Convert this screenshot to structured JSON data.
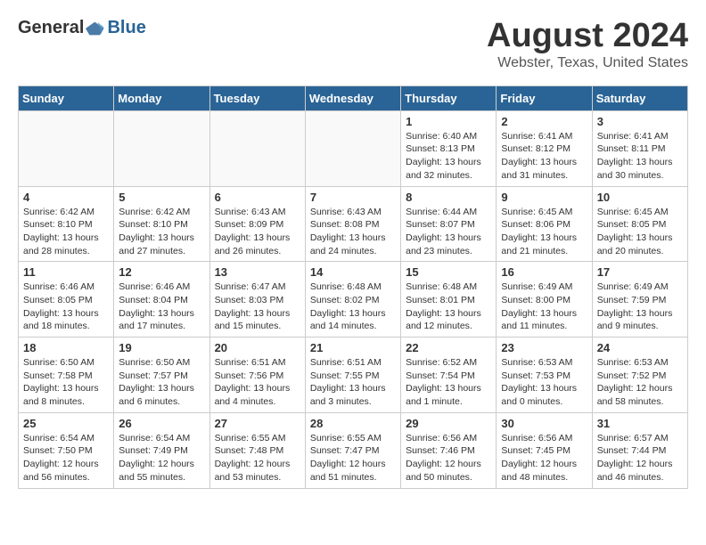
{
  "logo": {
    "general": "General",
    "blue": "Blue"
  },
  "title": "August 2024",
  "subtitle": "Webster, Texas, United States",
  "days_of_week": [
    "Sunday",
    "Monday",
    "Tuesday",
    "Wednesday",
    "Thursday",
    "Friday",
    "Saturday"
  ],
  "weeks": [
    [
      {
        "day": "",
        "info": ""
      },
      {
        "day": "",
        "info": ""
      },
      {
        "day": "",
        "info": ""
      },
      {
        "day": "",
        "info": ""
      },
      {
        "day": "1",
        "info": "Sunrise: 6:40 AM\nSunset: 8:13 PM\nDaylight: 13 hours\nand 32 minutes."
      },
      {
        "day": "2",
        "info": "Sunrise: 6:41 AM\nSunset: 8:12 PM\nDaylight: 13 hours\nand 31 minutes."
      },
      {
        "day": "3",
        "info": "Sunrise: 6:41 AM\nSunset: 8:11 PM\nDaylight: 13 hours\nand 30 minutes."
      }
    ],
    [
      {
        "day": "4",
        "info": "Sunrise: 6:42 AM\nSunset: 8:10 PM\nDaylight: 13 hours\nand 28 minutes."
      },
      {
        "day": "5",
        "info": "Sunrise: 6:42 AM\nSunset: 8:10 PM\nDaylight: 13 hours\nand 27 minutes."
      },
      {
        "day": "6",
        "info": "Sunrise: 6:43 AM\nSunset: 8:09 PM\nDaylight: 13 hours\nand 26 minutes."
      },
      {
        "day": "7",
        "info": "Sunrise: 6:43 AM\nSunset: 8:08 PM\nDaylight: 13 hours\nand 24 minutes."
      },
      {
        "day": "8",
        "info": "Sunrise: 6:44 AM\nSunset: 8:07 PM\nDaylight: 13 hours\nand 23 minutes."
      },
      {
        "day": "9",
        "info": "Sunrise: 6:45 AM\nSunset: 8:06 PM\nDaylight: 13 hours\nand 21 minutes."
      },
      {
        "day": "10",
        "info": "Sunrise: 6:45 AM\nSunset: 8:05 PM\nDaylight: 13 hours\nand 20 minutes."
      }
    ],
    [
      {
        "day": "11",
        "info": "Sunrise: 6:46 AM\nSunset: 8:05 PM\nDaylight: 13 hours\nand 18 minutes."
      },
      {
        "day": "12",
        "info": "Sunrise: 6:46 AM\nSunset: 8:04 PM\nDaylight: 13 hours\nand 17 minutes."
      },
      {
        "day": "13",
        "info": "Sunrise: 6:47 AM\nSunset: 8:03 PM\nDaylight: 13 hours\nand 15 minutes."
      },
      {
        "day": "14",
        "info": "Sunrise: 6:48 AM\nSunset: 8:02 PM\nDaylight: 13 hours\nand 14 minutes."
      },
      {
        "day": "15",
        "info": "Sunrise: 6:48 AM\nSunset: 8:01 PM\nDaylight: 13 hours\nand 12 minutes."
      },
      {
        "day": "16",
        "info": "Sunrise: 6:49 AM\nSunset: 8:00 PM\nDaylight: 13 hours\nand 11 minutes."
      },
      {
        "day": "17",
        "info": "Sunrise: 6:49 AM\nSunset: 7:59 PM\nDaylight: 13 hours\nand 9 minutes."
      }
    ],
    [
      {
        "day": "18",
        "info": "Sunrise: 6:50 AM\nSunset: 7:58 PM\nDaylight: 13 hours\nand 8 minutes."
      },
      {
        "day": "19",
        "info": "Sunrise: 6:50 AM\nSunset: 7:57 PM\nDaylight: 13 hours\nand 6 minutes."
      },
      {
        "day": "20",
        "info": "Sunrise: 6:51 AM\nSunset: 7:56 PM\nDaylight: 13 hours\nand 4 minutes."
      },
      {
        "day": "21",
        "info": "Sunrise: 6:51 AM\nSunset: 7:55 PM\nDaylight: 13 hours\nand 3 minutes."
      },
      {
        "day": "22",
        "info": "Sunrise: 6:52 AM\nSunset: 7:54 PM\nDaylight: 13 hours\nand 1 minute."
      },
      {
        "day": "23",
        "info": "Sunrise: 6:53 AM\nSunset: 7:53 PM\nDaylight: 13 hours\nand 0 minutes."
      },
      {
        "day": "24",
        "info": "Sunrise: 6:53 AM\nSunset: 7:52 PM\nDaylight: 12 hours\nand 58 minutes."
      }
    ],
    [
      {
        "day": "25",
        "info": "Sunrise: 6:54 AM\nSunset: 7:50 PM\nDaylight: 12 hours\nand 56 minutes."
      },
      {
        "day": "26",
        "info": "Sunrise: 6:54 AM\nSunset: 7:49 PM\nDaylight: 12 hours\nand 55 minutes."
      },
      {
        "day": "27",
        "info": "Sunrise: 6:55 AM\nSunset: 7:48 PM\nDaylight: 12 hours\nand 53 minutes."
      },
      {
        "day": "28",
        "info": "Sunrise: 6:55 AM\nSunset: 7:47 PM\nDaylight: 12 hours\nand 51 minutes."
      },
      {
        "day": "29",
        "info": "Sunrise: 6:56 AM\nSunset: 7:46 PM\nDaylight: 12 hours\nand 50 minutes."
      },
      {
        "day": "30",
        "info": "Sunrise: 6:56 AM\nSunset: 7:45 PM\nDaylight: 12 hours\nand 48 minutes."
      },
      {
        "day": "31",
        "info": "Sunrise: 6:57 AM\nSunset: 7:44 PM\nDaylight: 12 hours\nand 46 minutes."
      }
    ]
  ]
}
